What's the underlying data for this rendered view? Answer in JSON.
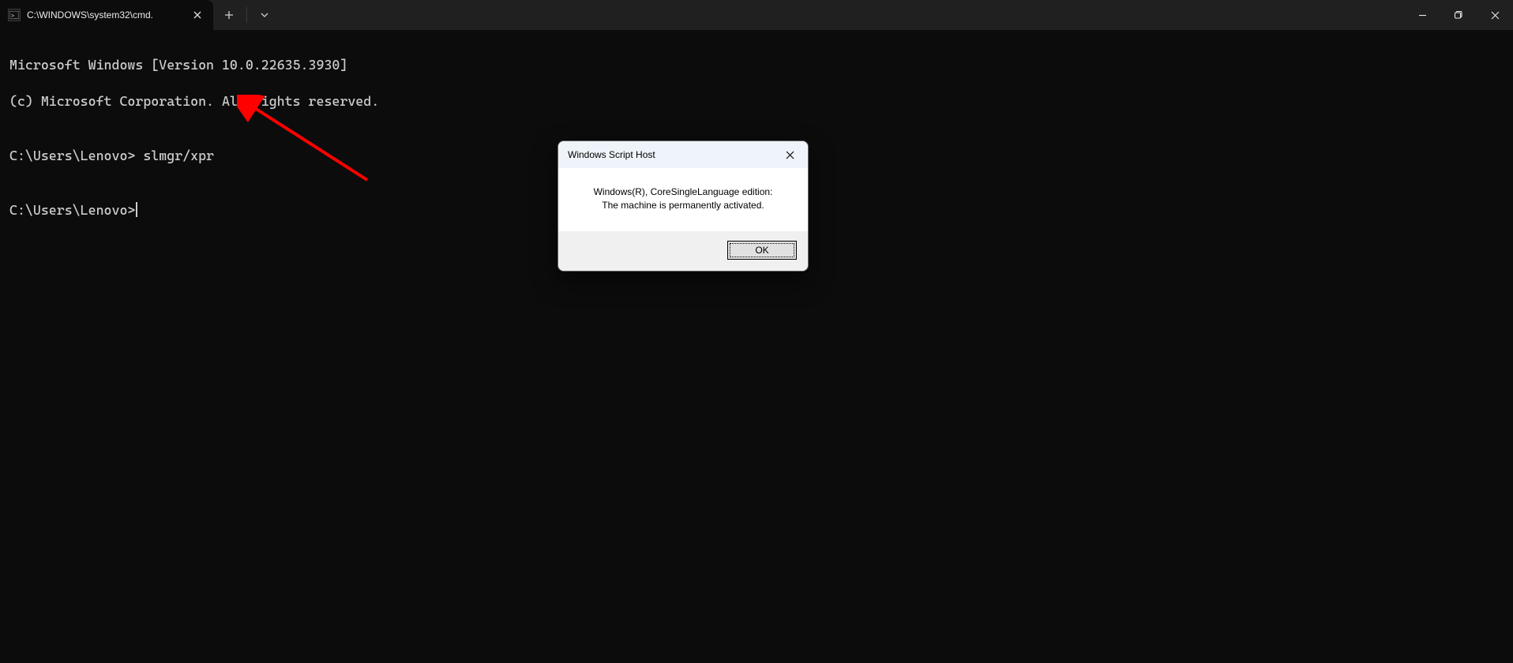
{
  "titlebar": {
    "tab": {
      "title": "C:\\WINDOWS\\system32\\cmd."
    }
  },
  "terminal": {
    "lines": {
      "l1": "Microsoft Windows [Version 10.0.22635.3930]",
      "l2": "(c) Microsoft Corporation. All rights reserved.",
      "l3": "",
      "l4_prompt": "C:\\Users\\Lenovo> ",
      "l4_cmd": "slmgr/xpr",
      "l5": "",
      "l6_prompt": "C:\\Users\\Lenovo>"
    }
  },
  "dialog": {
    "title": "Windows Script Host",
    "msg_line1": "Windows(R), CoreSingleLanguage edition:",
    "msg_line2": "The machine is permanently activated.",
    "ok_label": "OK"
  },
  "annotation": {
    "arrow_color": "#ff0000"
  }
}
